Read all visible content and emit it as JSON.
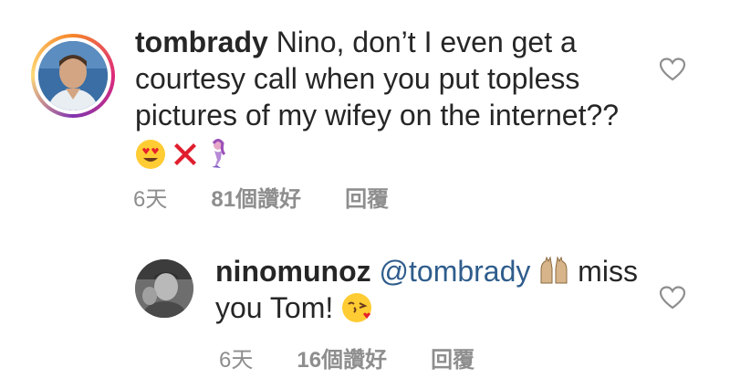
{
  "comments": [
    {
      "username": "tombrady",
      "text_line1": " Nino, don’t I even get a",
      "text_line2": "courtesy call when you put topless",
      "text_line3": "pictures of my wifey on the internet??",
      "emojis": [
        "heart-eyes-emoji",
        "red-cross-emoji",
        "mermaid-emoji"
      ],
      "time": "6天",
      "likes": "81個讚好",
      "reply": "回覆",
      "has_story_ring": true
    },
    {
      "username": "ninomunoz",
      "mention": " @tombrady",
      "text_after": " miss",
      "text_line2": "you Tom! ",
      "emojis": [
        "raising-hands-emoji",
        "kissing-face-emoji"
      ],
      "time": "6天",
      "likes": "16個讚好",
      "reply": "回覆",
      "has_story_ring": false
    }
  ],
  "colors": {
    "text": "#262626",
    "meta": "#8e8e8e",
    "mention": "#2f5d8c",
    "background": "#ffffff"
  },
  "icons": {
    "like": "heart-outline-icon"
  }
}
